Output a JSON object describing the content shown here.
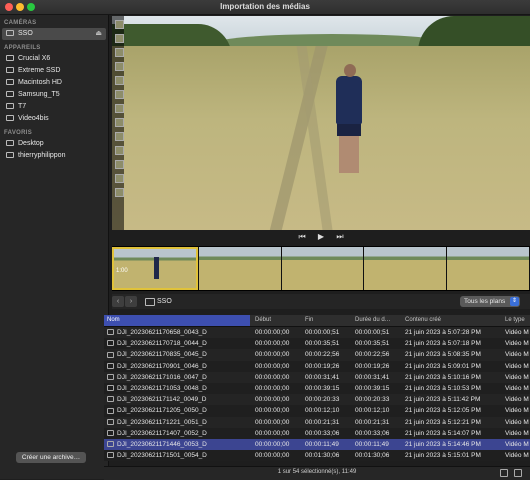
{
  "window": {
    "title": "Importation des médias"
  },
  "sidebar": {
    "sections": [
      {
        "title": "CAMÉRAS",
        "items": [
          {
            "label": "SSO",
            "icon": "drive-icon",
            "selected": true,
            "eject": true
          }
        ]
      },
      {
        "title": "APPAREILS",
        "items": [
          {
            "label": "Crucial X6",
            "icon": "drive-icon"
          },
          {
            "label": "Extreme SSD",
            "icon": "drive-icon"
          },
          {
            "label": "Macintosh HD",
            "icon": "drive-icon"
          },
          {
            "label": "Samsung_T5",
            "icon": "drive-icon"
          },
          {
            "label": "T7",
            "icon": "drive-icon"
          },
          {
            "label": "Video4bis",
            "icon": "drive-icon"
          }
        ]
      },
      {
        "title": "FAVORIS",
        "items": [
          {
            "label": "Desktop",
            "icon": "folder-icon"
          },
          {
            "label": "thierryphilippon",
            "icon": "home-icon"
          }
        ]
      }
    ],
    "archive_button": "Créer une archive…"
  },
  "transport": {
    "prev": "⏮",
    "play": "▶",
    "next": "⏭"
  },
  "thumbnails": {
    "first_label": "1:00"
  },
  "browser": {
    "location": "SSO",
    "filter": "Tous les plans",
    "columns": [
      "Nom",
      "Début",
      "Fin",
      "Durée du d…",
      "Contenu créé",
      "Le type"
    ],
    "rows": [
      {
        "name": "DJI_20230621170658_0043_D",
        "start": "00:00:00;00",
        "end": "00:00:00;51",
        "dur": "00:00:00;51",
        "created": "21 juin 2023 à 5:07:28 PM",
        "type": "Vidéo M"
      },
      {
        "name": "DJI_20230621170718_0044_D",
        "start": "00:00:00;00",
        "end": "00:00:35;51",
        "dur": "00:00:35;51",
        "created": "21 juin 2023 à 5:07:18 PM",
        "type": "Vidéo M"
      },
      {
        "name": "DJI_20230621170835_0045_D",
        "start": "00:00:00;00",
        "end": "00:00:22;56",
        "dur": "00:00:22;56",
        "created": "21 juin 2023 à 5:08:35 PM",
        "type": "Vidéo M"
      },
      {
        "name": "DJI_20230621170901_0046_D",
        "start": "00:00:00;00",
        "end": "00:00:19;26",
        "dur": "00:00:19;26",
        "created": "21 juin 2023 à 5:09:01 PM",
        "type": "Vidéo M"
      },
      {
        "name": "DJI_20230621171016_0047_D",
        "start": "00:00:00;00",
        "end": "00:00:31;41",
        "dur": "00:00:31;41",
        "created": "21 juin 2023 à 5:10:16 PM",
        "type": "Vidéo M"
      },
      {
        "name": "DJI_20230621171053_0048_D",
        "start": "00:00:00;00",
        "end": "00:00:39:15",
        "dur": "00:00:39:15",
        "created": "21 juin 2023 à 5:10:53 PM",
        "type": "Vidéo M"
      },
      {
        "name": "DJI_20230621171142_0049_D",
        "start": "00:00:00;00",
        "end": "00:00:20:33",
        "dur": "00:00:20:33",
        "created": "21 juin 2023 à 5:11:42 PM",
        "type": "Vidéo M"
      },
      {
        "name": "DJI_20230621171205_0050_D",
        "start": "00:00:00;00",
        "end": "00:00:12;10",
        "dur": "00:00:12;10",
        "created": "21 juin 2023 à 5:12:05 PM",
        "type": "Vidéo M"
      },
      {
        "name": "DJI_20230621171221_0051_D",
        "start": "00:00:00;00",
        "end": "00:00:21;31",
        "dur": "00:00:21;31",
        "created": "21 juin 2023 à 5:12:21 PM",
        "type": "Vidéo M"
      },
      {
        "name": "DJI_20230621171407_0052_D",
        "start": "00:00:00;00",
        "end": "00:00:33;06",
        "dur": "00:00:33;06",
        "created": "21 juin 2023 à 5:14:07 PM",
        "type": "Vidéo M"
      },
      {
        "name": "DJI_20230621171446_0053_D",
        "start": "00:00:00;00",
        "end": "00:00:11;49",
        "dur": "00:00:11;49",
        "created": "21 juin 2023 à 5:14:46 PM",
        "type": "Vidéo M",
        "selected": true
      },
      {
        "name": "DJI_20230621171501_0054_D",
        "start": "00:00:00;00",
        "end": "00:01:30;06",
        "dur": "00:01:30;06",
        "created": "21 juin 2023 à 5:15:01 PM",
        "type": "Vidéo M"
      }
    ],
    "status": "1 sur 54 sélectionné(s), 11:49"
  }
}
